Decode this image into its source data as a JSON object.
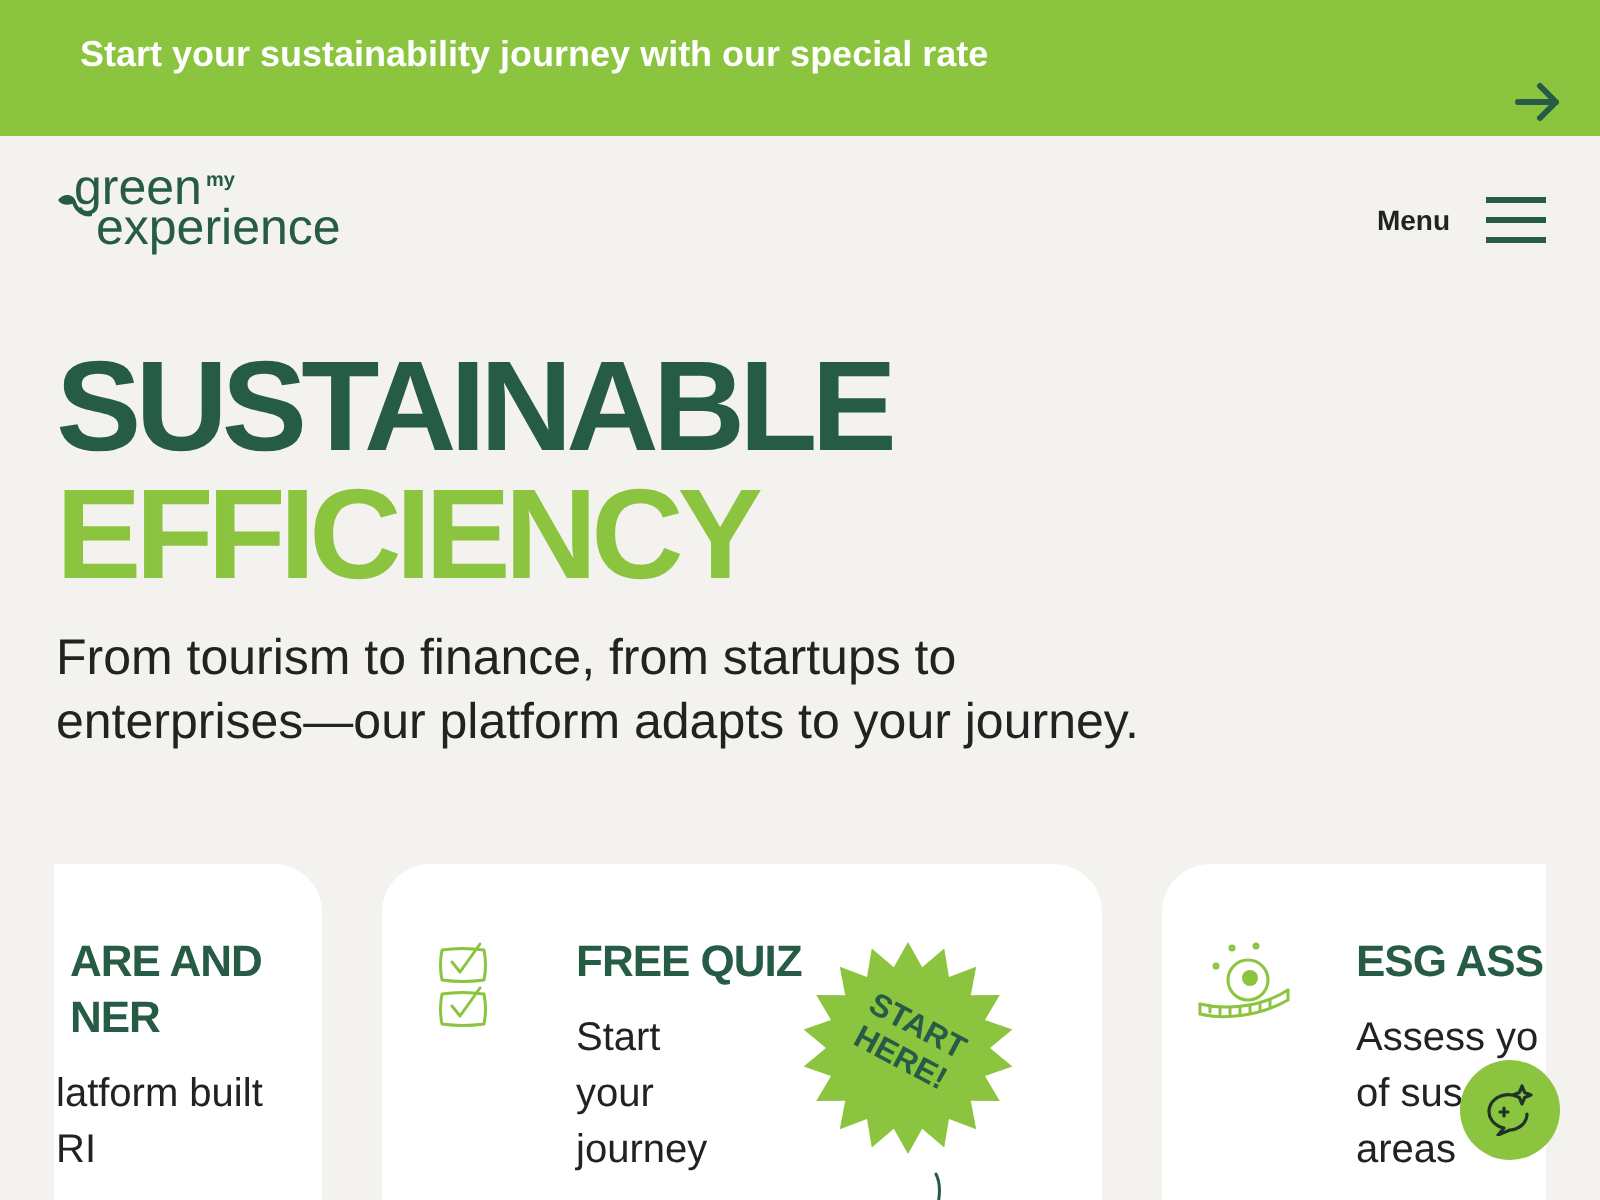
{
  "promo_banner": {
    "text": "Start your sustainability journey with our special rate"
  },
  "header": {
    "logo": {
      "word_1": "green",
      "word_2": "my",
      "word_3": "experience"
    },
    "menu_label": "Menu"
  },
  "hero": {
    "title_line_1": "SUSTAINABLE",
    "title_line_2": "EFFICIENCY",
    "subtitle": "From tourism to finance, from startups to enterprises—our platform adapts to your journey."
  },
  "cards": [
    {
      "kind": "cut-left",
      "title_lines": [
        "ARE AND",
        "NER"
      ],
      "body_lines": [
        "latform built",
        "RI"
      ]
    },
    {
      "kind": "checklist",
      "title_lines": [
        "FREE QUIZ"
      ],
      "body_lines": [
        "Start",
        "your",
        "journey"
      ],
      "sticker": "START HERE!"
    },
    {
      "kind": "tape-measure",
      "title_lines": [
        "ESG ASS"
      ],
      "body_lines": [
        "Assess yo",
        "of sus",
        "areas"
      ]
    }
  ]
}
